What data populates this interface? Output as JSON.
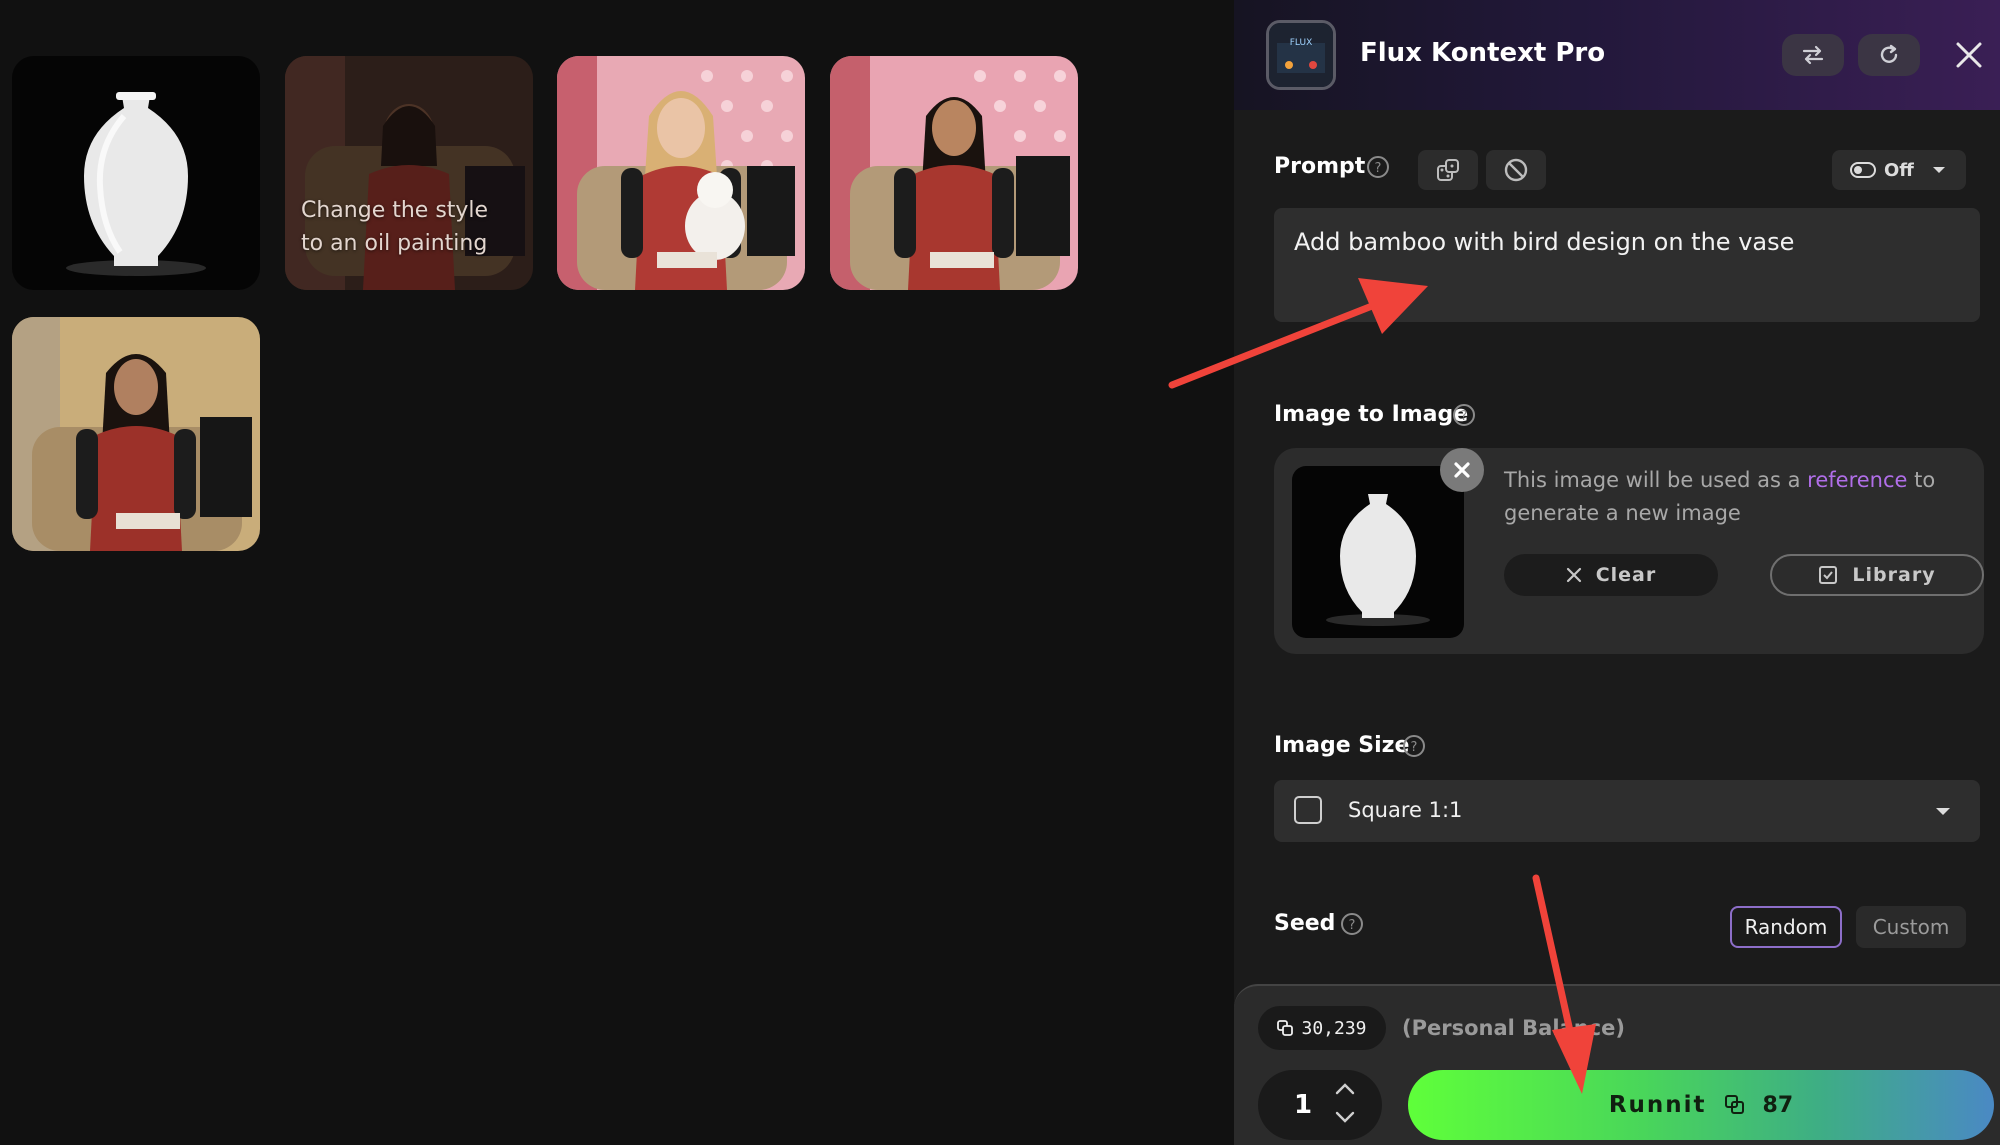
{
  "gallery": {
    "items": [
      {
        "name": "white-vase-image",
        "caption": ""
      },
      {
        "name": "oil-painting-woman-image",
        "caption": "Change the style to an oil painting"
      },
      {
        "name": "blonde-woman-with-cat-image",
        "caption": ""
      },
      {
        "name": "woman-in-armchair-image",
        "caption": ""
      },
      {
        "name": "woman-in-armchair-warm-image",
        "caption": ""
      }
    ]
  },
  "panel": {
    "title": "Flux Kontext Pro",
    "logo_text": "FLUX",
    "prompt": {
      "label": "Prompt",
      "toggle_label": "Off",
      "value": "Add bamboo with bird design on the vase"
    },
    "image_to_image": {
      "label": "Image to Image",
      "desc_before": "This image will be used as a ",
      "desc_link": "reference",
      "desc_after": " to generate a new image",
      "clear_label": "Clear",
      "library_label": "Library"
    },
    "image_size": {
      "label": "Image Size",
      "selected": "Square 1:1"
    },
    "seed": {
      "label": "Seed",
      "random_label": "Random",
      "custom_label": "Custom"
    },
    "footer": {
      "balance": "30,239",
      "balance_note": "(Personal Balance)",
      "quantity": "1",
      "run_label": "Runnit",
      "run_cost": "87"
    }
  },
  "colors": {
    "background": "#111111",
    "panel": "#1b1b1b",
    "accent_purple": "#b06ee8",
    "run_green": "#5fff3a",
    "annotation_red": "#f0433a"
  }
}
